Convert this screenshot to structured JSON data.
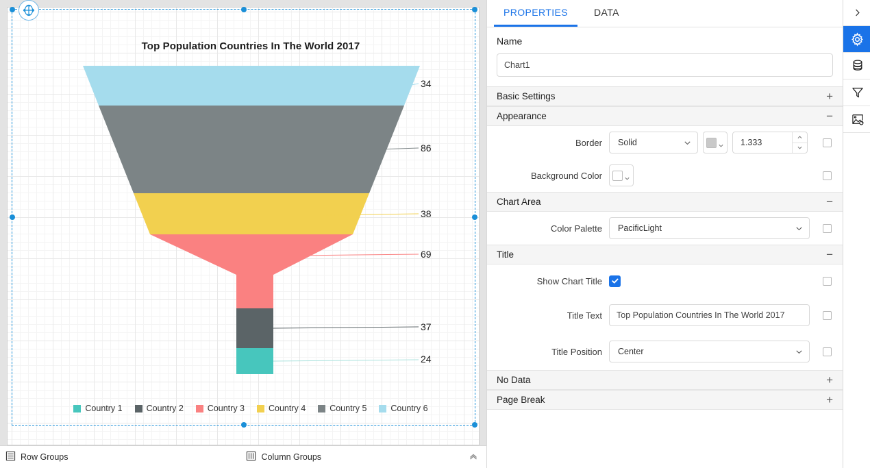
{
  "chart_data": {
    "type": "funnel",
    "title": "Top Population Countries In The World 2017",
    "categories": [
      "Country 1",
      "Country 2",
      "Country 3",
      "Country 4",
      "Country 5",
      "Country 6"
    ],
    "segments": [
      {
        "label": "Country 6",
        "value": 34,
        "color": "#a5dced"
      },
      {
        "label": "Country 5",
        "value": 86,
        "color": "#7c8486"
      },
      {
        "label": "Country 4",
        "value": 38,
        "color": "#f2d04f"
      },
      {
        "label": "Country 3",
        "value": 69,
        "color": "#fa8181"
      },
      {
        "label": "Country 2",
        "value": 37,
        "color": "#5b6467"
      },
      {
        "label": "Country 1",
        "value": 24,
        "color": "#47c6bd"
      }
    ],
    "data_labels": [
      "34",
      "86",
      "38",
      "69",
      "37",
      "24"
    ],
    "legend": [
      {
        "label": "Country 1",
        "color": "#47c6bd"
      },
      {
        "label": "Country 2",
        "color": "#5b6467"
      },
      {
        "label": "Country 3",
        "color": "#fa8181"
      },
      {
        "label": "Country 4",
        "color": "#f2d04f"
      },
      {
        "label": "Country 5",
        "color": "#7c8486"
      },
      {
        "label": "Country 6",
        "color": "#a5dced"
      }
    ],
    "legend_position": "bottom",
    "grid": true,
    "palette": "PacificLight"
  },
  "design_surface": {
    "move_handle_icon": "move-crosshair-icon"
  },
  "groups_bar": {
    "row_groups_label": "Row Groups",
    "row_groups_icon": "rows-icon",
    "column_groups_label": "Column Groups",
    "column_groups_icon": "columns-icon",
    "collapse_icon": "chevron-up-icon"
  },
  "panel": {
    "tabs": [
      {
        "label": "PROPERTIES",
        "active": true
      },
      {
        "label": "DATA",
        "active": false
      }
    ],
    "accent_color": "#1a73e8",
    "name": {
      "label": "Name",
      "value": "Chart1",
      "placeholder": "Chart1"
    },
    "sections": [
      {
        "title": "Basic Settings",
        "toggle": "+"
      },
      {
        "title": "Appearance",
        "toggle": "−"
      },
      {
        "title": "Chart Area",
        "toggle": "−"
      },
      {
        "title": "Title",
        "toggle": "−"
      },
      {
        "title": "No Data",
        "toggle": "+"
      },
      {
        "title": "Page Break",
        "toggle": "+"
      }
    ],
    "appearance": {
      "border_label": "Border",
      "border_style": "Solid",
      "border_color": "#c9c9c9",
      "border_width": "1.333",
      "background_label": "Background Color",
      "background_color": "#ffffff"
    },
    "chart_area": {
      "color_palette_label": "Color Palette",
      "color_palette_value": "PacificLight"
    },
    "title": {
      "show_chart_title_label": "Show Chart Title",
      "show_chart_title_checked": true,
      "title_text_label": "Title Text",
      "title_text_value": "Top Population Countries In The World 2017",
      "title_position_label": "Title Position",
      "title_position_value": "Center"
    }
  },
  "icon_rail": {
    "items": [
      {
        "name": "expand-chevron-right-icon",
        "active": false
      },
      {
        "name": "gear-icon",
        "active": true
      },
      {
        "name": "database-icon",
        "active": false
      },
      {
        "name": "filter-funnel-icon",
        "active": false
      },
      {
        "name": "image-settings-icon",
        "active": false
      }
    ]
  }
}
